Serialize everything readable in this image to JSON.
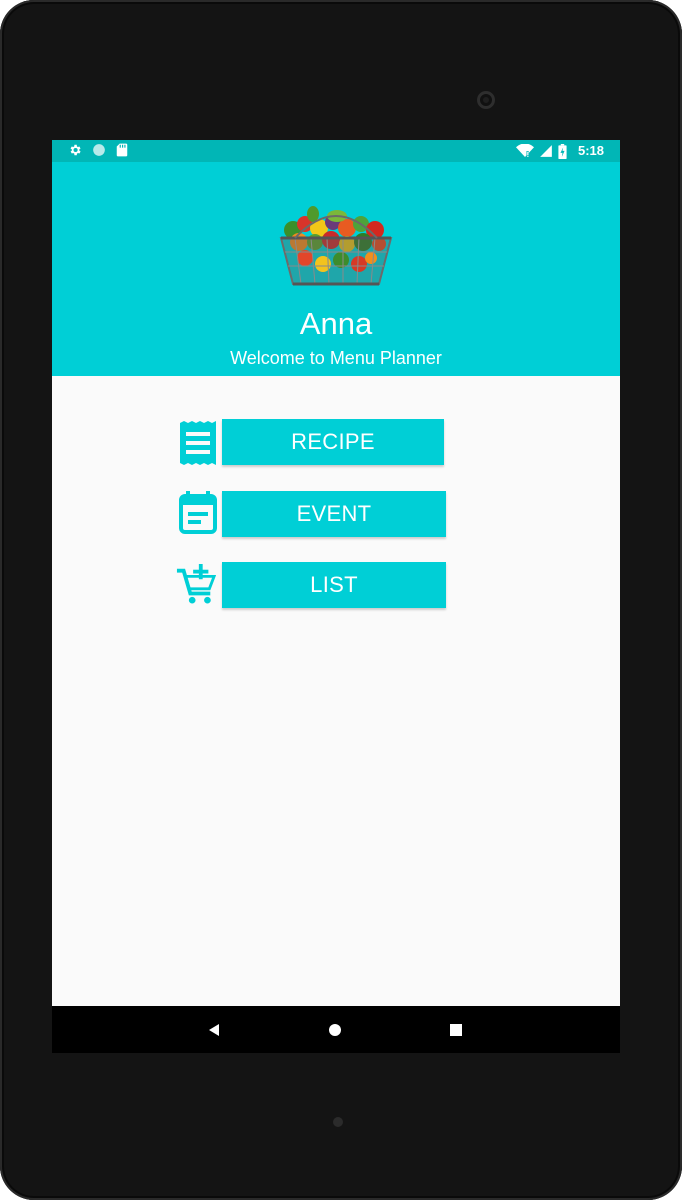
{
  "status_bar": {
    "time": "5:18",
    "left_icons": [
      "settings-icon",
      "circle-notification-icon",
      "sd-card-icon"
    ],
    "right_icons": [
      "wifi-icon",
      "cell-signal-icon",
      "battery-charging-icon"
    ]
  },
  "header": {
    "user_name": "Anna",
    "welcome": "Welcome to Menu Planner",
    "logo_icon": "grocery-basket-icon"
  },
  "menu": [
    {
      "label": "RECIPE",
      "icon": "receipt-icon"
    },
    {
      "label": "EVENT",
      "icon": "calendar-icon"
    },
    {
      "label": "LIST",
      "icon": "add-to-cart-icon"
    }
  ],
  "nav_bar": {
    "buttons": [
      "back-icon",
      "home-icon",
      "recents-icon"
    ]
  },
  "colors": {
    "accent": "#00cfd6",
    "status_bar": "#01b6b6",
    "background": "#fafafa",
    "text_on_accent": "#ffffff"
  }
}
